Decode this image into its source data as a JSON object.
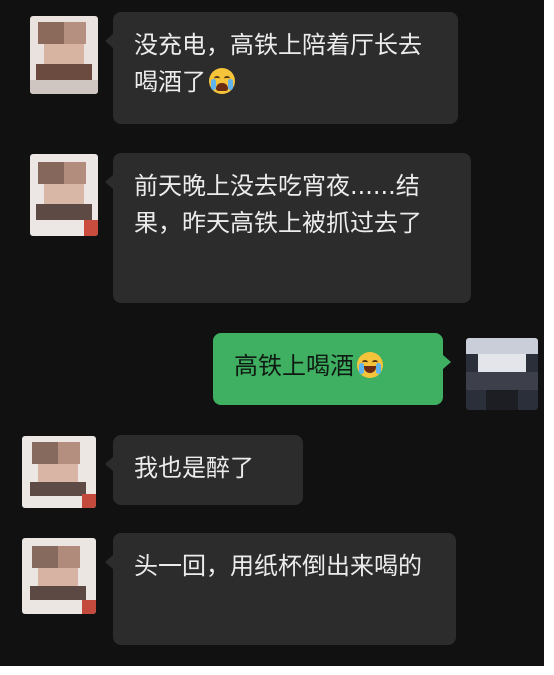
{
  "chat": {
    "messages": [
      {
        "id": "m1",
        "sender": "other",
        "text": "没充电，高铁上陪着厅长去喝酒了",
        "emoji": "loudly-crying-face-emoji"
      },
      {
        "id": "m2",
        "sender": "other",
        "text": "前天晚上没去吃宵夜......结果，昨天高铁上被抓过去了",
        "emoji": ""
      },
      {
        "id": "m3",
        "sender": "self",
        "text": "高铁上喝酒",
        "emoji": "tears-of-joy-emoji"
      },
      {
        "id": "m4",
        "sender": "other",
        "text": "我也是醉了",
        "emoji": ""
      },
      {
        "id": "m5",
        "sender": "other",
        "text": "头一回，用纸杯倒出来喝的",
        "emoji": ""
      }
    ]
  },
  "colors": {
    "chat_background": "#111111",
    "incoming_bubble": "#2c2c2c",
    "outgoing_bubble": "#3fb062",
    "incoming_text": "#ececec",
    "outgoing_text": "#0f1a12"
  }
}
